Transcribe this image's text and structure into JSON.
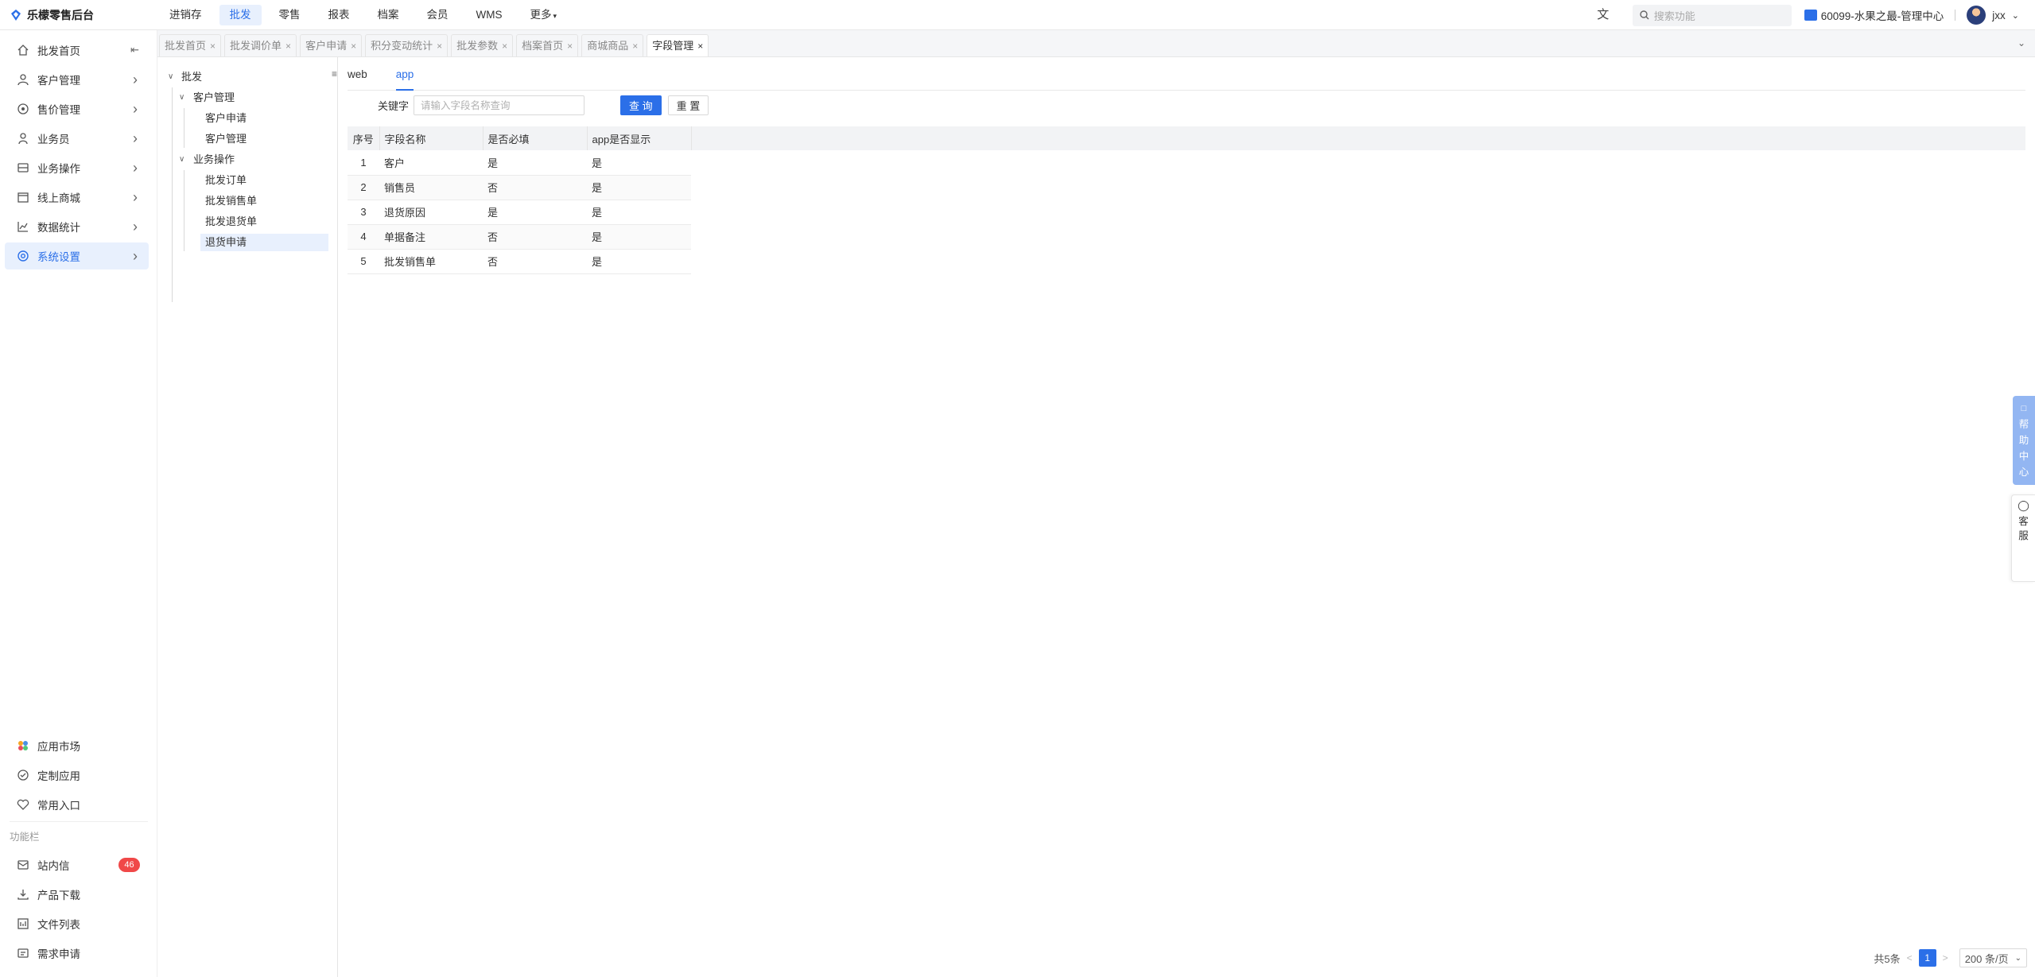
{
  "app": {
    "title": "乐檬零售后台"
  },
  "topnav": [
    {
      "label": "进销存",
      "active": false
    },
    {
      "label": "批发",
      "active": true
    },
    {
      "label": "零售",
      "active": false
    },
    {
      "label": "报表",
      "active": false
    },
    {
      "label": "档案",
      "active": false
    },
    {
      "label": "会员",
      "active": false
    },
    {
      "label": "WMS",
      "active": false
    },
    {
      "label": "更多",
      "active": false
    }
  ],
  "header": {
    "search_placeholder": "搜索功能",
    "store": "60099-水果之最-管理中心",
    "user": "jxx"
  },
  "sidebar": {
    "items": [
      {
        "label": "批发首页",
        "icon": "home-icon"
      },
      {
        "label": "客户管理",
        "icon": "user-icon"
      },
      {
        "label": "售价管理",
        "icon": "price-icon"
      },
      {
        "label": "业务员",
        "icon": "person-icon"
      },
      {
        "label": "业务操作",
        "icon": "operation-icon"
      },
      {
        "label": "线上商城",
        "icon": "shop-icon"
      },
      {
        "label": "数据统计",
        "icon": "chart-icon"
      },
      {
        "label": "系统设置",
        "icon": "settings-icon"
      }
    ],
    "bottom": [
      {
        "label": "应用市场",
        "icon": "app-market-icon"
      },
      {
        "label": "定制应用",
        "icon": "custom-app-icon"
      },
      {
        "label": "常用入口",
        "icon": "heart-icon"
      }
    ],
    "section_label": "功能栏",
    "function_items": [
      {
        "label": "站内信",
        "icon": "mail-icon",
        "badge": "46"
      },
      {
        "label": "产品下载",
        "icon": "download-icon"
      },
      {
        "label": "文件列表",
        "icon": "file-list-icon"
      },
      {
        "label": "需求申请",
        "icon": "request-icon"
      }
    ]
  },
  "tabs": [
    {
      "label": "批发首页",
      "active": false
    },
    {
      "label": "批发调价单",
      "active": false
    },
    {
      "label": "客户申请",
      "active": false
    },
    {
      "label": "积分变动统计",
      "active": false
    },
    {
      "label": "批发参数",
      "active": false
    },
    {
      "label": "档案首页",
      "active": false
    },
    {
      "label": "商城商品",
      "active": false
    },
    {
      "label": "字段管理",
      "active": true
    }
  ],
  "tree": {
    "root": "批发",
    "groups": [
      {
        "label": "客户管理",
        "children": [
          "客户申请",
          "客户管理"
        ]
      },
      {
        "label": "业务操作",
        "children": [
          "批发订单",
          "批发销售单",
          "批发退货单",
          "退货申请"
        ]
      }
    ],
    "selected": "退货申请"
  },
  "subtabs": [
    {
      "label": "web",
      "active": false
    },
    {
      "label": "app",
      "active": true
    }
  ],
  "filter": {
    "label": "关键字",
    "placeholder": "请输入字段名称查询",
    "query_button": "查 询",
    "reset_button": "重 置"
  },
  "table": {
    "columns": [
      "序号",
      "字段名称",
      "是否必填",
      "app是否显示"
    ],
    "rows": [
      [
        "1",
        "客户",
        "是",
        "是"
      ],
      [
        "2",
        "销售员",
        "否",
        "是"
      ],
      [
        "3",
        "退货原因",
        "是",
        "是"
      ],
      [
        "4",
        "单据备注",
        "否",
        "是"
      ],
      [
        "5",
        "批发销售单",
        "否",
        "是"
      ]
    ]
  },
  "pager": {
    "total": "共5条",
    "page": "1",
    "size": "200 条/页"
  },
  "floats": {
    "help": [
      "帮",
      "助",
      "中",
      "心"
    ],
    "service": [
      "客",
      "服"
    ]
  },
  "colors": {
    "primary": "#2b6fe8",
    "badge": "#f04848",
    "active_bg": "#e8f0fd"
  }
}
